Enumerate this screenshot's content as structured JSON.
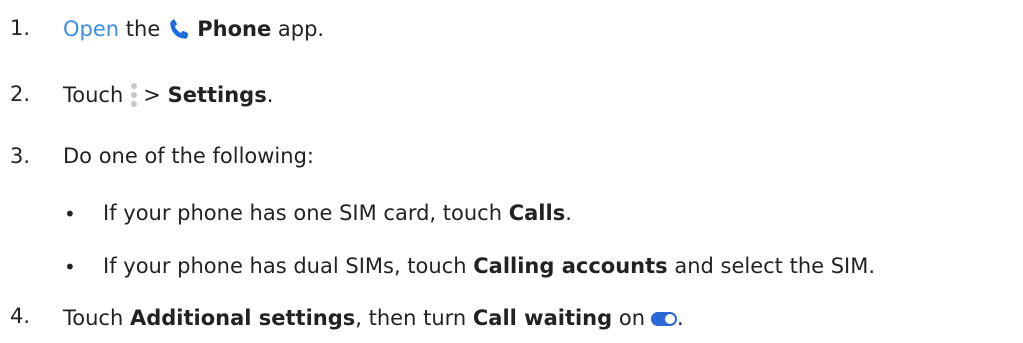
{
  "steps": [
    {
      "num": "1.",
      "link": "Open",
      "pre": "the",
      "bold": "Phone",
      "post": "app."
    },
    {
      "num": "2.",
      "pre": "Touch",
      "mid": ">",
      "bold": "Settings",
      "post": "."
    },
    {
      "num": "3.",
      "text": "Do one of the following:"
    },
    {
      "num": "4.",
      "pre": "Touch",
      "bold1": "Additional settings",
      "mid": ", then turn",
      "bold2": "Call waiting",
      "post": "on",
      "end": "."
    }
  ],
  "bullets": [
    {
      "symbol": "•",
      "pre": "If your phone has one SIM card, touch",
      "bold": "Calls",
      "post": "."
    },
    {
      "symbol": "•",
      "pre": "If your phone has dual SIMs, touch",
      "bold": "Calling accounts",
      "post": "and select the SIM."
    }
  ],
  "icons": {
    "phone": "phone-icon",
    "menu": "more-vert-icon",
    "toggle": "toggle-on-icon"
  },
  "colors": {
    "link": "#3d8fe6",
    "phone_icon": "#1d6ce0",
    "toggle": "#2a67d8"
  },
  "toggle_state": "on"
}
